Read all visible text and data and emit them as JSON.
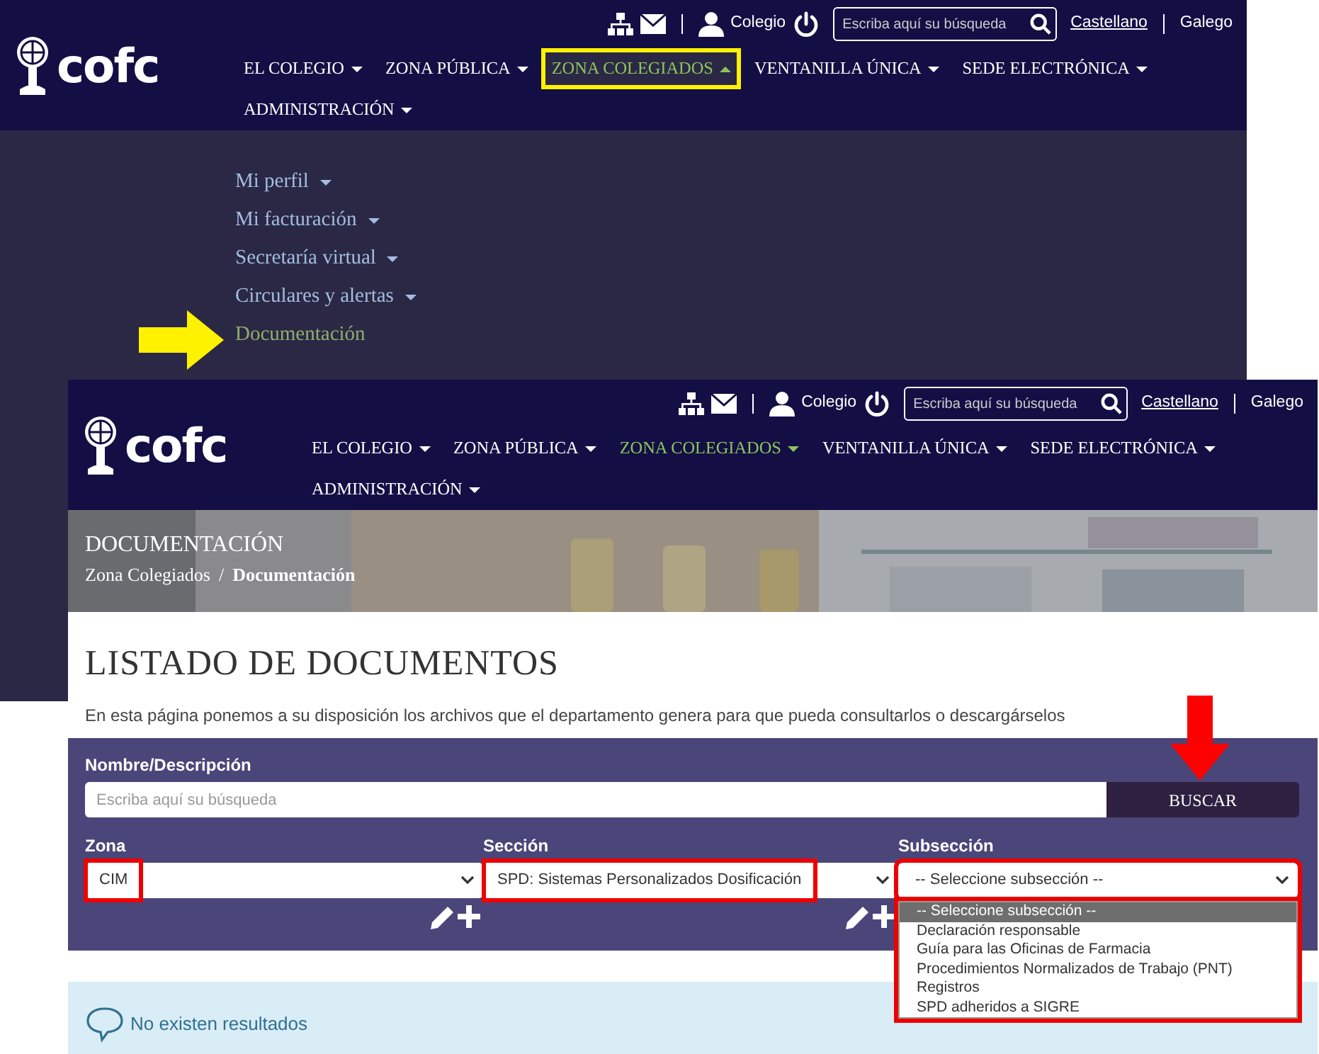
{
  "back_screen": {
    "header": {
      "logo": "cofc",
      "user_label": "Colegio",
      "search_placeholder": "Escriba aquí su búsqueda",
      "languages": [
        {
          "label": "Castellano",
          "selected": true
        },
        {
          "label": "Galego",
          "selected": false
        }
      ],
      "nav": [
        {
          "label": "EL COLEGIO",
          "active": false,
          "expanded": false,
          "outlined": false
        },
        {
          "label": "ZONA PÚBLICA",
          "active": false,
          "expanded": false,
          "outlined": false
        },
        {
          "label": "ZONA COLEGIADOS",
          "active": true,
          "expanded": true,
          "outlined": true
        },
        {
          "label": "VENTANILLA ÚNICA",
          "active": false,
          "expanded": false,
          "outlined": false
        },
        {
          "label": "SEDE ELECTRÓNICA",
          "active": false,
          "expanded": false,
          "outlined": false
        },
        {
          "label": "ADMINISTRACIÓN",
          "active": false,
          "expanded": false,
          "outlined": false
        }
      ]
    },
    "submenu": [
      {
        "label": "Mi perfil",
        "has_menu": true,
        "selected": false
      },
      {
        "label": "Mi facturación",
        "has_menu": true,
        "selected": false
      },
      {
        "label": "Secretaría virtual",
        "has_menu": true,
        "selected": false
      },
      {
        "label": "Circulares y alertas",
        "has_menu": true,
        "selected": false
      },
      {
        "label": "Documentación",
        "has_menu": false,
        "selected": true
      }
    ]
  },
  "front_screen": {
    "header": {
      "logo": "cofc",
      "user_label": "Colegio",
      "search_placeholder": "Escriba aquí su búsqueda",
      "languages": [
        {
          "label": "Castellano",
          "selected": true
        },
        {
          "label": "Galego",
          "selected": false
        }
      ],
      "nav": [
        {
          "label": "EL COLEGIO",
          "active": false,
          "expanded": false,
          "outlined": false
        },
        {
          "label": "ZONA PÚBLICA",
          "active": false,
          "expanded": false,
          "outlined": false
        },
        {
          "label": "ZONA COLEGIADOS",
          "active": true,
          "expanded": false,
          "outlined": false
        },
        {
          "label": "VENTANILLA ÚNICA",
          "active": false,
          "expanded": false,
          "outlined": false
        },
        {
          "label": "SEDE ELECTRÓNICA",
          "active": false,
          "expanded": false,
          "outlined": false
        },
        {
          "label": "ADMINISTRACIÓN",
          "active": false,
          "expanded": false,
          "outlined": false
        }
      ]
    },
    "banner": {
      "title": "DOCUMENTACIÓN",
      "separator": "/",
      "breadcrumb": [
        {
          "label": "Zona Colegiados",
          "current": false
        },
        {
          "label": "Documentación",
          "current": true
        }
      ]
    },
    "heading": "LISTADO DE DOCUMENTOS",
    "description": "En esta página ponemos a su disposición los archivos que el departamento genera para que pueda consultarlos o descargárselos",
    "filter": {
      "name_label": "Nombre/Descripción",
      "name_placeholder": "Escriba aquí su búsqueda",
      "search_button": "BUSCAR",
      "selects": [
        {
          "label": "Zona",
          "value": "CIM",
          "outlined": true,
          "expanded": false,
          "actions": true
        },
        {
          "label": "Sección",
          "value": "SPD: Sistemas Personalizados Dosificación",
          "outlined": true,
          "expanded": false,
          "actions": true
        },
        {
          "label": "Subsección",
          "value": "-- Seleccione subsección --",
          "outlined": true,
          "expanded": true,
          "actions": false,
          "options": [
            {
              "label": "-- Seleccione subsección --",
              "selected": true
            },
            {
              "label": "Declaración responsable",
              "selected": false
            },
            {
              "label": "Guía para las Oficinas de Farmacia",
              "selected": false
            },
            {
              "label": "Procedimientos Normalizados de Trabajo (PNT)",
              "selected": false
            },
            {
              "label": "Registros",
              "selected": false
            },
            {
              "label": "SPD adheridos a SIGRE",
              "selected": false
            }
          ]
        }
      ]
    },
    "alert": "No existen resultados"
  }
}
